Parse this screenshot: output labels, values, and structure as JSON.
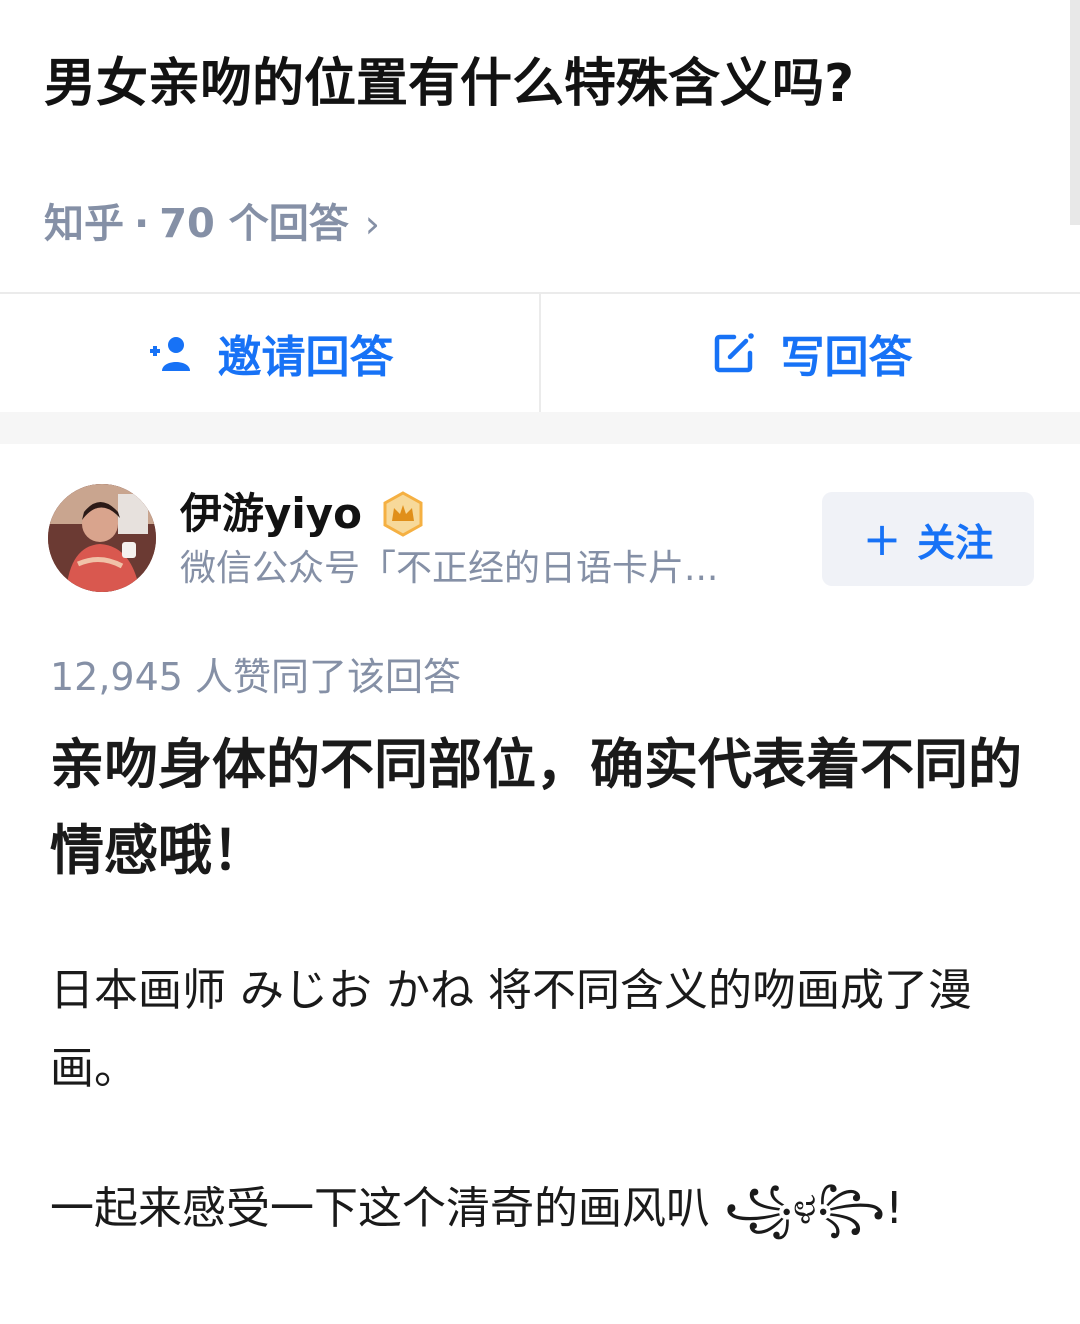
{
  "question": {
    "title": "男女亲吻的位置有什么特殊含义吗?",
    "site": "知乎",
    "separator": "·",
    "answer_count": "70 个回答",
    "chevron": "›"
  },
  "actions": {
    "invite": {
      "label": "邀请回答",
      "icon": "add-person-icon"
    },
    "write": {
      "label": "写回答",
      "icon": "edit-icon"
    }
  },
  "author": {
    "name": "伊游yiyo",
    "badge_icon": "crown-badge-icon",
    "bio": "微信公众号「不正经的日语卡片...",
    "follow_label": "关注",
    "follow_icon": "+"
  },
  "answer": {
    "votes": "12,945 人赞同了该回答",
    "headline": "亲吻身体的不同部位，确实代表着不同的情感哦！",
    "paragraphs": [
      "日本画师 みじお かね 将不同含义的吻画成了漫画。",
      "一起来感受一下这个清奇的画风叭 ꧁ಳ꧂!"
    ]
  },
  "colors": {
    "accent": "#1772f6",
    "meta": "#8590a6",
    "badge": "#f5b042"
  }
}
